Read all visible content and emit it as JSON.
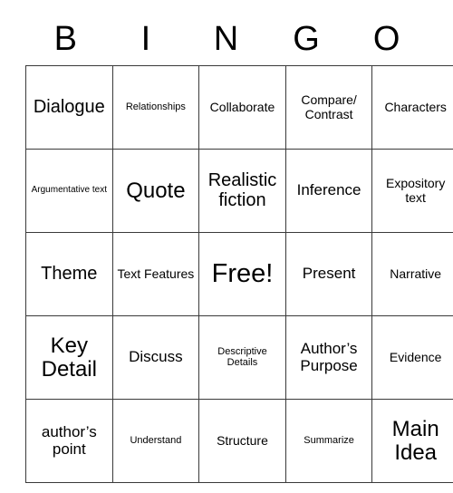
{
  "card": {
    "header_letters": [
      "B",
      "I",
      "N",
      "G",
      "O"
    ],
    "border_color": "#3a3a3a",
    "background_color": "#ffffff",
    "text_color": "#000000",
    "rows": [
      [
        {
          "text": "Dialogue",
          "size": "t-xl"
        },
        {
          "text": "Relationships",
          "size": "t-s"
        },
        {
          "text": "Collaborate",
          "size": "t-m"
        },
        {
          "text": "Compare/ Contrast",
          "size": "t-m"
        },
        {
          "text": "Characters",
          "size": "t-m"
        }
      ],
      [
        {
          "text": "Argumentative text",
          "size": "t-xs"
        },
        {
          "text": "Quote",
          "size": "t-xxl"
        },
        {
          "text": "Realistic fiction",
          "size": "t-xl"
        },
        {
          "text": "Inference",
          "size": "t-l"
        },
        {
          "text": "Expository text",
          "size": "t-m"
        }
      ],
      [
        {
          "text": "Theme",
          "size": "t-xl"
        },
        {
          "text": "Text Features",
          "size": "t-m"
        },
        {
          "text": "Free!",
          "size": "t-free"
        },
        {
          "text": "Present",
          "size": "t-l"
        },
        {
          "text": "Narrative",
          "size": "t-m"
        }
      ],
      [
        {
          "text": "Key Detail",
          "size": "t-xxl"
        },
        {
          "text": "Discuss",
          "size": "t-l"
        },
        {
          "text": "Descriptive Details",
          "size": "t-s"
        },
        {
          "text": "Author’s Purpose",
          "size": "t-l"
        },
        {
          "text": "Evidence",
          "size": "t-m"
        }
      ],
      [
        {
          "text": "author’s point",
          "size": "t-l"
        },
        {
          "text": "Understand",
          "size": "t-s"
        },
        {
          "text": "Structure",
          "size": "t-m"
        },
        {
          "text": "Summarize",
          "size": "t-s"
        },
        {
          "text": "Main Idea",
          "size": "t-xxl"
        }
      ]
    ]
  }
}
